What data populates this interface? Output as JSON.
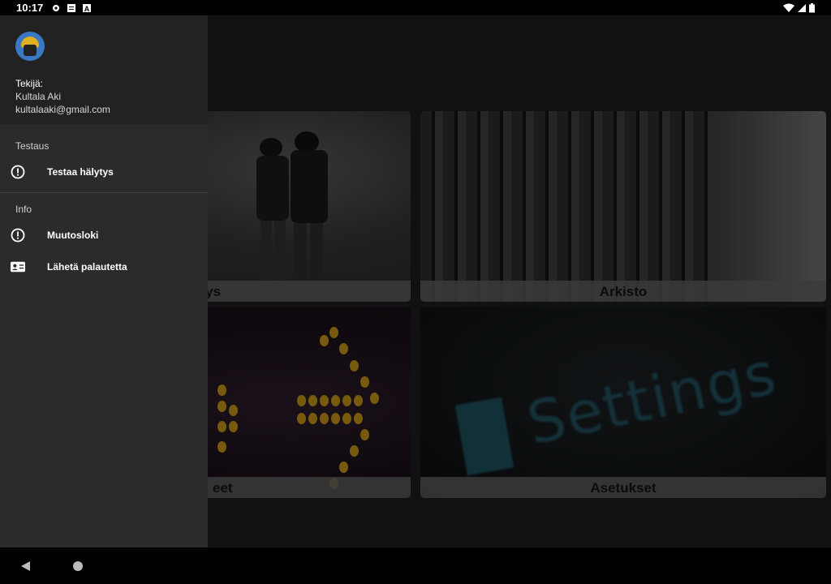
{
  "status_bar": {
    "time": "10:17",
    "left_icons": [
      "gear-icon",
      "notes-icon",
      "a-icon"
    ],
    "right_icons": [
      "wifi-icon",
      "signal-icon",
      "battery-icon"
    ]
  },
  "drawer": {
    "author_label": "Tekijä:",
    "author_name": "Kultala Aki",
    "author_email": "kultalaaki@gmail.com",
    "sections": [
      {
        "title": "Testaus",
        "items": [
          {
            "label": "Testaa hälytys",
            "icon": "alert-circle-icon"
          }
        ]
      },
      {
        "title": "Info",
        "items": [
          {
            "label": "Muutosloki",
            "icon": "alert-circle-icon"
          },
          {
            "label": "Lähetä palautetta",
            "icon": "contact-card-icon"
          }
        ]
      }
    ]
  },
  "cards": {
    "alarm_caption": "ytys",
    "archive_caption": "Arkisto",
    "arrows_caption": "eet",
    "settings_caption": "Asetukset",
    "settings_sign_text": "Settings"
  },
  "colors": {
    "drawer_bg": "#2b2b2b",
    "drawer_header_bg": "#222222",
    "caption_bg": "#5a5a5a"
  }
}
